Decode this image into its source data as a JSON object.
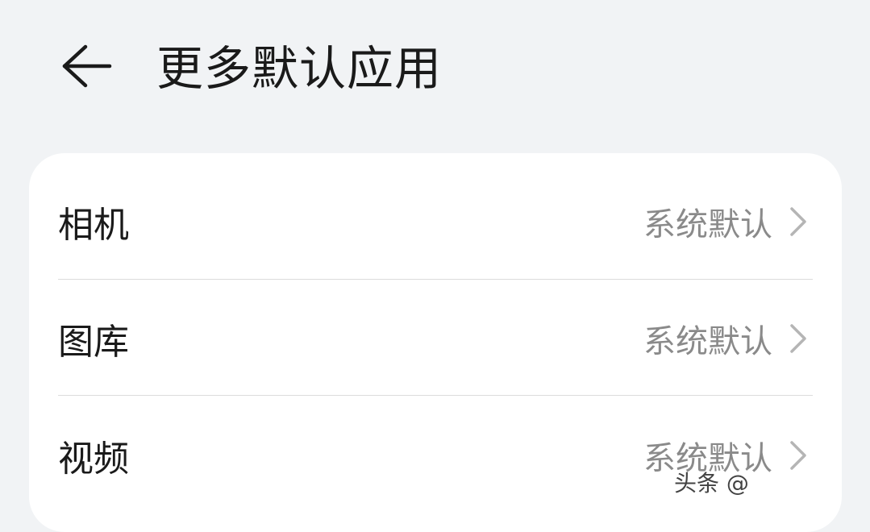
{
  "header": {
    "back_icon": "arrow-left-icon",
    "title": "更多默认应用"
  },
  "settings": {
    "items": [
      {
        "label": "相机",
        "value": "系统默认",
        "icon": "chevron-right-icon"
      },
      {
        "label": "图库",
        "value": "系统默认",
        "icon": "chevron-right-icon"
      },
      {
        "label": "视频",
        "value": "系统默认",
        "icon": "chevron-right-icon"
      }
    ]
  },
  "watermark": {
    "text": "头条 @"
  },
  "colors": {
    "background": "#f1f3f5",
    "card": "#ffffff",
    "text_primary": "#1a1a1a",
    "text_secondary": "#8a8a8a",
    "divider": "#dcdcdc"
  }
}
